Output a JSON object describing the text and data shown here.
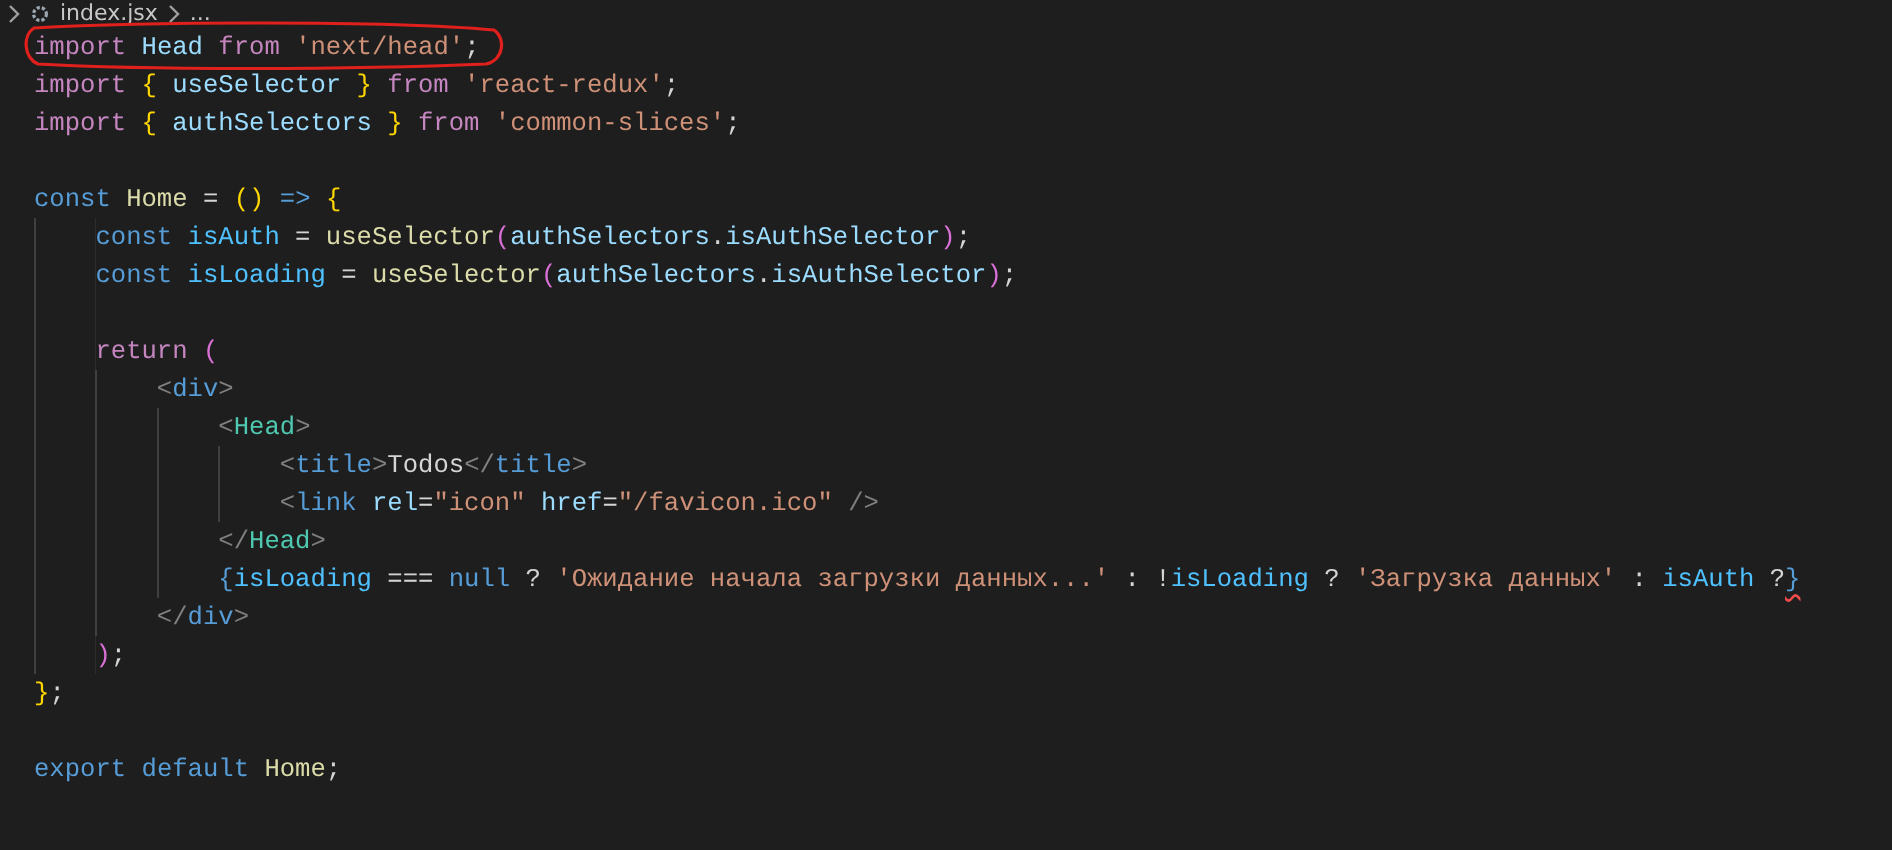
{
  "breadcrumb": {
    "items": [
      "index.jsx",
      "..."
    ]
  },
  "lines": [
    {
      "circled": true,
      "gap_after": false,
      "tokens": [
        {
          "text": "import ",
          "kind": "kw"
        },
        {
          "text": "Head ",
          "kind": "var"
        },
        {
          "text": "from ",
          "kind": "kw"
        },
        {
          "text": "'next/head'",
          "kind": "str"
        },
        {
          "text": ";"
        }
      ]
    },
    {
      "circled": false,
      "gap_after": false,
      "tokens": [
        {
          "text": "import ",
          "kind": "kw"
        },
        {
          "text": "{ ",
          "kind": "b1"
        },
        {
          "text": "useSelector ",
          "kind": "var"
        },
        {
          "text": "} ",
          "kind": "b1"
        },
        {
          "text": "from ",
          "kind": "kw"
        },
        {
          "text": "'react-redux'",
          "kind": "str"
        },
        {
          "text": ";"
        }
      ]
    },
    {
      "circled": false,
      "gap_after": true,
      "tokens": [
        {
          "text": "import ",
          "kind": "kw"
        },
        {
          "text": "{ ",
          "kind": "b1"
        },
        {
          "text": "authSelectors ",
          "kind": "var"
        },
        {
          "text": "} ",
          "kind": "b1"
        },
        {
          "text": "from ",
          "kind": "kw"
        },
        {
          "text": "'common-slices'",
          "kind": "str"
        },
        {
          "text": ";"
        }
      ]
    },
    {
      "circled": false,
      "gap_after": false,
      "tokens": [
        {
          "text": "const ",
          "kind": "storage"
        },
        {
          "text": "Home",
          "kind": "fn"
        },
        {
          "text": " = "
        },
        {
          "text": "() ",
          "kind": "b1"
        },
        {
          "text": "=> ",
          "kind": "storage"
        },
        {
          "text": "{",
          "kind": "b1"
        }
      ]
    },
    {
      "circled": false,
      "gap_after": false,
      "tokens": [
        {
          "text": "    const ",
          "kind": "storage"
        },
        {
          "text": "isAuth",
          "kind": "const"
        },
        {
          "text": " = "
        },
        {
          "text": "useSelector",
          "kind": "fn"
        },
        {
          "text": "(",
          "kind": "b2"
        },
        {
          "text": "authSelectors",
          "kind": "var"
        },
        {
          "text": "."
        },
        {
          "text": "isAuthSelector",
          "kind": "var"
        },
        {
          "text": ")",
          "kind": "b2"
        },
        {
          "text": ";"
        }
      ]
    },
    {
      "circled": false,
      "gap_after": true,
      "tokens": [
        {
          "text": "    const ",
          "kind": "storage"
        },
        {
          "text": "isLoading",
          "kind": "const"
        },
        {
          "text": " = "
        },
        {
          "text": "useSelector",
          "kind": "fn"
        },
        {
          "text": "(",
          "kind": "b2"
        },
        {
          "text": "authSelectors",
          "kind": "var"
        },
        {
          "text": "."
        },
        {
          "text": "isAuthSelector",
          "kind": "var"
        },
        {
          "text": ")",
          "kind": "b2"
        },
        {
          "text": ";"
        }
      ]
    },
    {
      "circled": false,
      "gap_after": false,
      "tokens": [
        {
          "text": "    return ",
          "kind": "kw"
        },
        {
          "text": "(",
          "kind": "b2"
        }
      ]
    },
    {
      "circled": false,
      "gap_after": false,
      "tokens": [
        {
          "text": "        <",
          "kind": "tag"
        },
        {
          "text": "div",
          "kind": "storage"
        },
        {
          "text": ">",
          "kind": "tag"
        }
      ]
    },
    {
      "circled": false,
      "gap_after": false,
      "tokens": [
        {
          "text": "            <",
          "kind": "tag"
        },
        {
          "text": "Head",
          "kind": "comp"
        },
        {
          "text": ">",
          "kind": "tag"
        }
      ]
    },
    {
      "circled": false,
      "gap_after": false,
      "tokens": [
        {
          "text": "                <",
          "kind": "tag"
        },
        {
          "text": "title",
          "kind": "storage"
        },
        {
          "text": ">",
          "kind": "tag"
        },
        {
          "text": "Todos"
        },
        {
          "text": "</",
          "kind": "tag"
        },
        {
          "text": "title",
          "kind": "storage"
        },
        {
          "text": ">",
          "kind": "tag"
        }
      ]
    },
    {
      "circled": false,
      "gap_after": false,
      "tokens": [
        {
          "text": "                <",
          "kind": "tag"
        },
        {
          "text": "link ",
          "kind": "storage"
        },
        {
          "text": "rel",
          "kind": "var"
        },
        {
          "text": "="
        },
        {
          "text": "\"icon\" ",
          "kind": "str"
        },
        {
          "text": "href",
          "kind": "var"
        },
        {
          "text": "="
        },
        {
          "text": "\"/favicon.ico\" ",
          "kind": "str"
        },
        {
          "text": "/>",
          "kind": "tag"
        }
      ]
    },
    {
      "circled": false,
      "gap_after": false,
      "tokens": [
        {
          "text": "            </",
          "kind": "tag"
        },
        {
          "text": "Head",
          "kind": "comp"
        },
        {
          "text": ">",
          "kind": "tag"
        }
      ]
    },
    {
      "circled": false,
      "gap_after": false,
      "tokens": [
        {
          "text": "            {",
          "kind": "storage"
        },
        {
          "text": "isLoading",
          "kind": "const"
        },
        {
          "text": " === "
        },
        {
          "text": "null",
          "kind": "storage"
        },
        {
          "text": " ? "
        },
        {
          "text": "'Ожидание начала загрузки данных...'",
          "kind": "str"
        },
        {
          "text": " : !"
        },
        {
          "text": "isLoading",
          "kind": "const"
        },
        {
          "text": " ? "
        },
        {
          "text": "'Загрузка данных'",
          "kind": "str"
        },
        {
          "text": " : "
        },
        {
          "text": "isAuth",
          "kind": "const"
        },
        {
          "text": " ?"
        },
        {
          "text": "}",
          "kind": "storage",
          "error": true
        }
      ]
    },
    {
      "circled": false,
      "gap_after": false,
      "tokens": [
        {
          "text": "        </",
          "kind": "tag"
        },
        {
          "text": "div",
          "kind": "storage"
        },
        {
          "text": ">",
          "kind": "tag"
        }
      ]
    },
    {
      "circled": false,
      "gap_after": false,
      "tokens": [
        {
          "text": "    )",
          "kind": "b2"
        },
        {
          "text": ";"
        }
      ]
    },
    {
      "circled": false,
      "gap_after": true,
      "tokens": [
        {
          "text": "}",
          "kind": "b1"
        },
        {
          "text": ";"
        }
      ]
    },
    {
      "circled": false,
      "gap_after": false,
      "tokens": [
        {
          "text": "export ",
          "kind": "storage"
        },
        {
          "text": "default ",
          "kind": "storage"
        },
        {
          "text": "Home",
          "kind": "fn"
        },
        {
          "text": ";"
        }
      ]
    }
  ]
}
